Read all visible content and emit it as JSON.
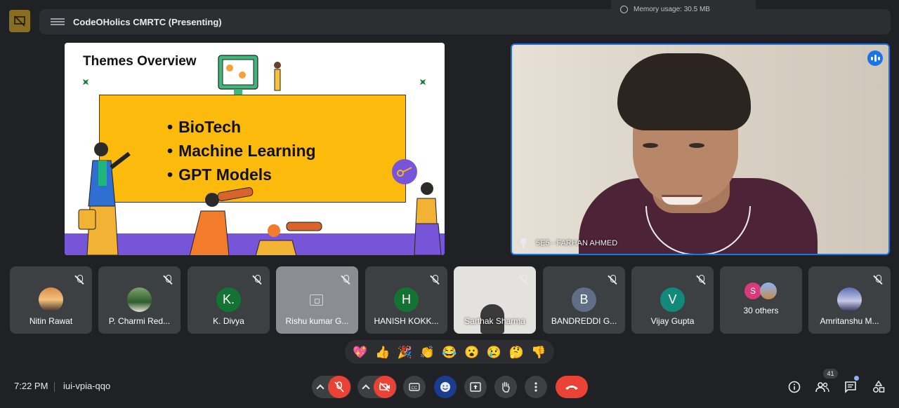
{
  "window": {
    "title": "CodeOHolics CMRTC (Presenting)",
    "memory_label": "Memory usage:",
    "memory_value": "30.5 MB"
  },
  "slide": {
    "title": "Themes Overview",
    "bullets": [
      "BioTech",
      "Machine Learning",
      "GPT Models"
    ],
    "board_color": "#fbba0c",
    "floor_color": "#7655d8"
  },
  "speaker": {
    "name": "5E5 - FARHAN AHMED",
    "highlight_color": "#1a73e8"
  },
  "participants": [
    {
      "name": "Nitin Rawat",
      "avatar": "photo"
    },
    {
      "name": "P. Charmi Red...",
      "avatar": "photo"
    },
    {
      "name": "K. Divya",
      "initial": "K.",
      "color": "#137333"
    },
    {
      "name": "Rishu kumar G...",
      "avatar": "camera-off"
    },
    {
      "name": "HANISH KOKK...",
      "initial": "H",
      "color": "#137333"
    },
    {
      "name": "Sarthak Sharma",
      "avatar": "video"
    },
    {
      "name": "BANDREDDI G...",
      "initial": "B",
      "color": "#5f6f85"
    },
    {
      "name": "Vijay Gupta",
      "initial": "V",
      "color": "#12897a"
    },
    {
      "name": "30 others",
      "initial": "S",
      "color": "#d93a7b"
    },
    {
      "name": "Amritanshu M...",
      "avatar": "photo"
    }
  ],
  "reactions": [
    "💖",
    "👍",
    "🎉",
    "👏",
    "😂",
    "😮",
    "😢",
    "🤔",
    "👎"
  ],
  "bottom": {
    "time": "7:22 PM",
    "meeting_code": "iui-vpia-qqo",
    "participant_count": "41"
  },
  "colors": {
    "background": "#202124",
    "tile": "#3c4043",
    "danger": "#ea4335"
  }
}
